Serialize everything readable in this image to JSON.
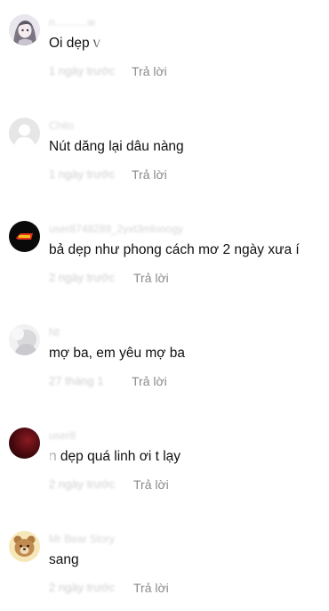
{
  "comments": [
    {
      "username": "n...........w",
      "text": "Oi dẹp v",
      "time": "1 ngày trước",
      "reply_label": "Trả lời",
      "avatar_icon": "anime-girl-avatar-icon"
    },
    {
      "username": "Chito",
      "text": "Nút dăng lại dâu nàng",
      "time": "1 ngày trước",
      "reply_label": "Trả lời",
      "avatar_icon": "default-user-avatar-icon"
    },
    {
      "username": "user8748289_2yxt3mlooogy",
      "text": "bả dẹp như phong cách mơ 2 ngày xưa í",
      "time": "2 ngày trước",
      "reply_label": "Trả lời",
      "avatar_icon": "logo-avatar-icon"
    },
    {
      "username": "Nt",
      "text": "mợ ba, em yêu mợ ba",
      "time": "27 tháng 1",
      "reply_label": "Trả lời",
      "avatar_icon": "grey-user-avatar-icon"
    },
    {
      "username": "user8",
      "text": "n dẹp quá linh ơi t lạy",
      "time": "2 ngày trước",
      "reply_label": "Trả lời",
      "avatar_icon": "dark-red-avatar-icon"
    },
    {
      "username": "Mr Bear Story",
      "text": "sang",
      "time": "2 ngày trước",
      "reply_label": "Trả lời",
      "avatar_icon": "bear-avatar-icon"
    }
  ],
  "colors": {
    "reply": "#8a8a8a",
    "text": "#111111",
    "background": "#ffffff"
  }
}
